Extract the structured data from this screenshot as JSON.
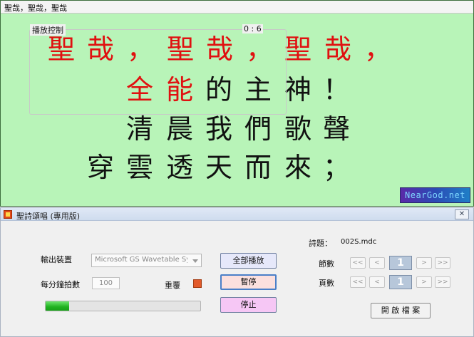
{
  "lyrics_window": {
    "title": "聖哉，聖哉，聖哉",
    "lines": [
      [
        {
          "text": "聖",
          "color": "#e01010"
        },
        {
          "text": "哉",
          "color": "#e01010"
        },
        {
          "text": "，",
          "color": "#e01010"
        },
        {
          "text": "聖",
          "color": "#e01010"
        },
        {
          "text": "哉",
          "color": "#e01010"
        },
        {
          "text": "，",
          "color": "#e01010"
        },
        {
          "text": "聖",
          "color": "#e01010"
        },
        {
          "text": "哉",
          "color": "#e01010"
        },
        {
          "text": "，",
          "color": "#e01010"
        }
      ],
      [
        {
          "text": "全",
          "color": "#e01010"
        },
        {
          "text": "能",
          "color": "#e01010"
        },
        {
          "text": "的",
          "color": "#111111"
        },
        {
          "text": "主",
          "color": "#111111"
        },
        {
          "text": "神",
          "color": "#111111"
        },
        {
          "text": "！",
          "color": "#111111"
        }
      ],
      [
        {
          "text": "清",
          "color": "#111111"
        },
        {
          "text": "晨",
          "color": "#111111"
        },
        {
          "text": "我",
          "color": "#111111"
        },
        {
          "text": "們",
          "color": "#111111"
        },
        {
          "text": "歌",
          "color": "#111111"
        },
        {
          "text": "聲",
          "color": "#111111"
        }
      ],
      [
        {
          "text": "穿",
          "color": "#111111"
        },
        {
          "text": "雲",
          "color": "#111111"
        },
        {
          "text": "透",
          "color": "#111111"
        },
        {
          "text": "天",
          "color": "#111111"
        },
        {
          "text": "而",
          "color": "#111111"
        },
        {
          "text": "來",
          "color": "#111111"
        },
        {
          "text": "；",
          "color": "#111111"
        }
      ]
    ],
    "watermark": "NearGod.net",
    "background_color": "#b8f4b8"
  },
  "player_window": {
    "title": "聖詩頌唱 (專用版)",
    "close_icon": "close-icon",
    "group_title": "播放控制",
    "time_display": "0 : 6",
    "device_label": "輸出裝置",
    "device_value": "Microsoft GS Wavetable Synth [E",
    "beats_label": "每分鐘拍數",
    "beats_value": "100",
    "repeat_label": "重覆",
    "play_all_label": "全部播放",
    "pause_label": "暫停",
    "stop_label": "停止",
    "progress": 0.15,
    "poem_label": "詩題：",
    "poem_file": "002S.mdc",
    "verse_label": "節數",
    "verse_value": "1",
    "page_label": "頁數",
    "page_value": "1",
    "nav": {
      "first": "<<",
      "prev": "<",
      "next": ">",
      "last": ">>"
    },
    "open_file_label": "開 啟 檔 案"
  }
}
